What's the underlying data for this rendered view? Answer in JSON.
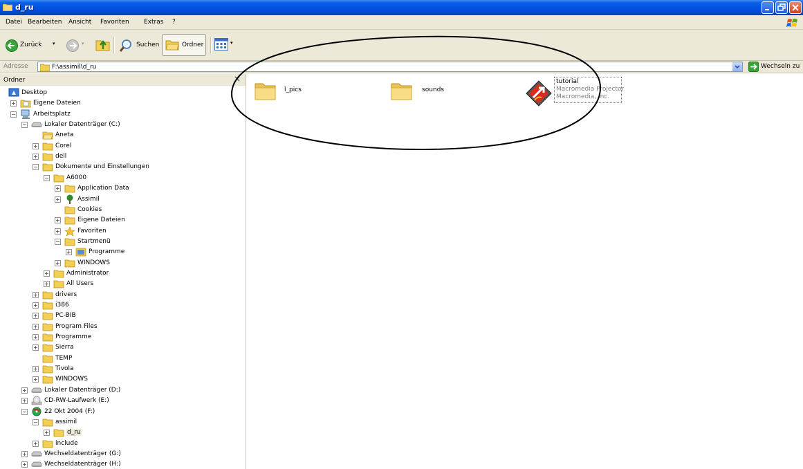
{
  "window": {
    "title": "d_ru"
  },
  "menu": [
    "Datei",
    "Bearbeiten",
    "Ansicht",
    "Favoriten",
    "Extras",
    "?"
  ],
  "toolbar": {
    "back": "Zurück",
    "search": "Suchen",
    "folders": "Ordner"
  },
  "address": {
    "label": "Adresse",
    "path": "F:\\assimil\\d_ru",
    "go": "Wechseln zu"
  },
  "folder_pane": {
    "title": "Ordner",
    "close": "×"
  },
  "tree": [
    {
      "label": "Desktop"
    },
    {
      "label": "Eigene Dateien"
    },
    {
      "label": "Arbeitsplatz"
    },
    {
      "label": "Lokaler Datenträger (C:)"
    },
    {
      "label": "Aneta"
    },
    {
      "label": "Corel"
    },
    {
      "label": "dell"
    },
    {
      "label": "Dokumente und Einstellungen"
    },
    {
      "label": "A6000"
    },
    {
      "label": "Application Data"
    },
    {
      "label": "Assimil"
    },
    {
      "label": "Cookies"
    },
    {
      "label": "Eigene Dateien"
    },
    {
      "label": "Favoriten"
    },
    {
      "label": "Startmenü"
    },
    {
      "label": "Programme"
    },
    {
      "label": "WINDOWS"
    },
    {
      "label": "Administrator"
    },
    {
      "label": "All Users"
    },
    {
      "label": "drivers"
    },
    {
      "label": "i386"
    },
    {
      "label": "PC-BIB"
    },
    {
      "label": "Program Files"
    },
    {
      "label": "Programme"
    },
    {
      "label": "Sierra"
    },
    {
      "label": "TEMP"
    },
    {
      "label": "Tivola"
    },
    {
      "label": "WINDOWS"
    },
    {
      "label": "Lokaler Datenträger (D:)"
    },
    {
      "label": "CD-RW-Laufwerk (E:)"
    },
    {
      "label": "22 Okt 2004 (F:)"
    },
    {
      "label": "assimil"
    },
    {
      "label": "d_ru",
      "selected": true
    },
    {
      "label": "include"
    },
    {
      "label": "Wechseldatenträger (G:)"
    },
    {
      "label": "Wechseldatenträger (H:)"
    }
  ],
  "files": [
    {
      "name": "l_pics",
      "type": "folder"
    },
    {
      "name": "sounds",
      "type": "folder"
    },
    {
      "name": "tutorial",
      "type": "app",
      "line2": "Macromedia Projector",
      "line3": "Macromedia, Inc."
    }
  ]
}
